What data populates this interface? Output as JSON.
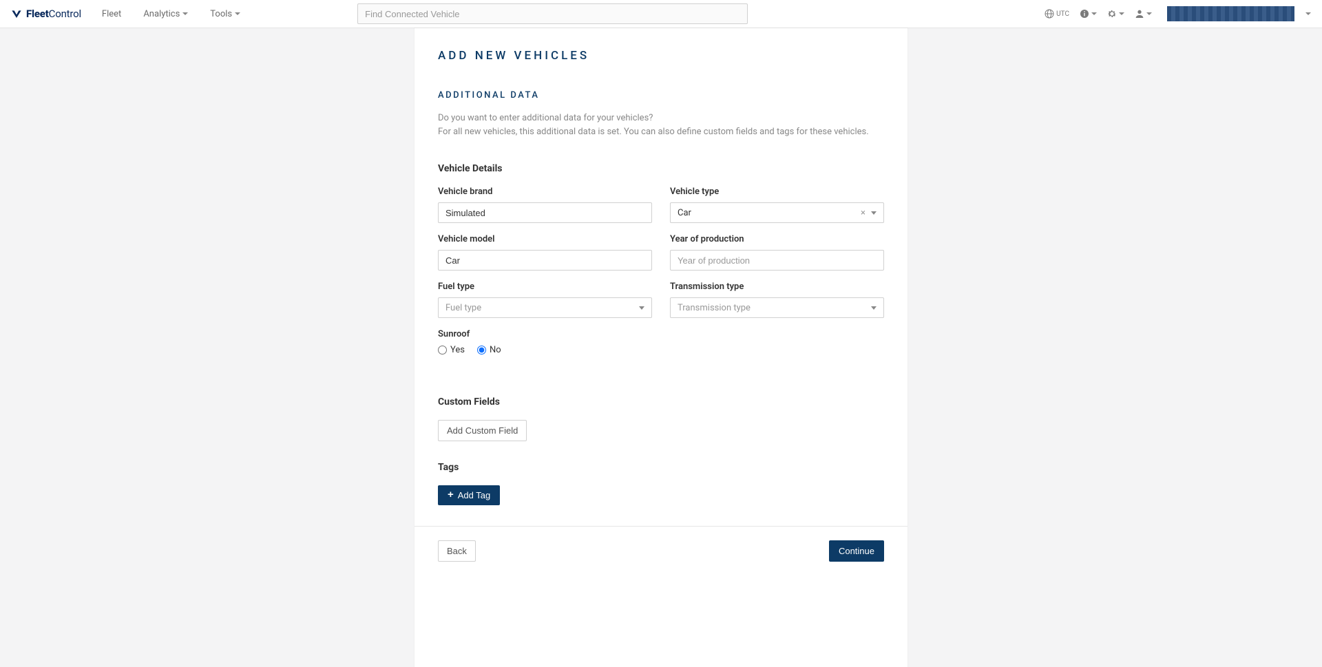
{
  "brand": {
    "bold": "Fleet",
    "light": "Control"
  },
  "nav": {
    "fleet": "Fleet",
    "analytics": "Analytics",
    "tools": "Tools"
  },
  "search": {
    "placeholder": "Find Connected Vehicle"
  },
  "topbar": {
    "tz": "UTC"
  },
  "page": {
    "title": "ADD NEW VEHICLES",
    "section_title": "ADDITIONAL DATA",
    "desc_line1": "Do you want to enter additional data for your vehicles?",
    "desc_line2": "For all new vehicles, this additional data is set. You can also define custom fields and tags for these vehicles."
  },
  "details": {
    "heading": "Vehicle Details",
    "brand_label": "Vehicle brand",
    "brand_value": "Simulated",
    "type_label": "Vehicle type",
    "type_value": "Car",
    "model_label": "Vehicle model",
    "model_value": "Car",
    "year_label": "Year of production",
    "year_placeholder": "Year of production",
    "fuel_label": "Fuel type",
    "fuel_placeholder": "Fuel type",
    "trans_label": "Transmission type",
    "trans_placeholder": "Transmission type",
    "sunroof_label": "Sunroof",
    "sunroof_yes": "Yes",
    "sunroof_no": "No"
  },
  "custom": {
    "heading": "Custom Fields",
    "add_button": "Add Custom Field"
  },
  "tags": {
    "heading": "Tags",
    "add_button": "Add Tag"
  },
  "footer": {
    "back": "Back",
    "continue": "Continue"
  }
}
